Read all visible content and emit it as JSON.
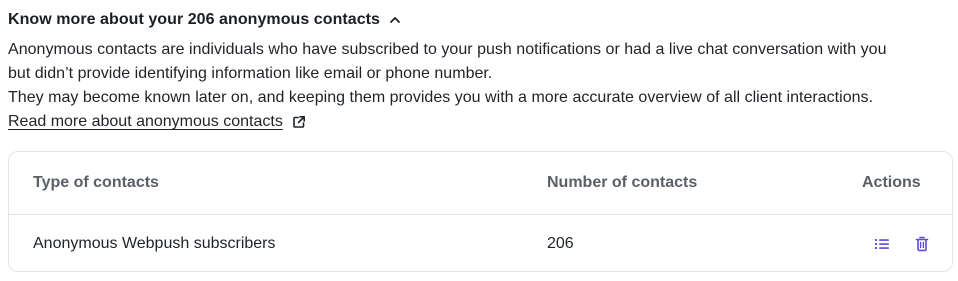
{
  "section": {
    "title": "Know more about your 206 anonymous contacts",
    "toggle_icon": "chevron-up-icon"
  },
  "description": {
    "line1": "Anonymous contacts are individuals who have subscribed to your push notifications or had a live chat conversation with you",
    "line2": "but didn’t provide identifying information like email or phone number.",
    "line3": "They may become known later on, and keeping them provides you with a more accurate overview of all client interactions."
  },
  "link": {
    "label": "Read more about anonymous contacts",
    "icon": "external-link-icon"
  },
  "table": {
    "headers": [
      "Type of contacts",
      "Number of contacts",
      "Actions"
    ],
    "rows": [
      {
        "type": "Anonymous Webpush subscribers",
        "count": "206",
        "actions": [
          "list-icon",
          "trash-icon"
        ]
      }
    ]
  },
  "colors": {
    "accent": "#5b4bdb",
    "text": "#1f2328",
    "muted_header": "#5b6067",
    "border": "#e3e5e8"
  }
}
